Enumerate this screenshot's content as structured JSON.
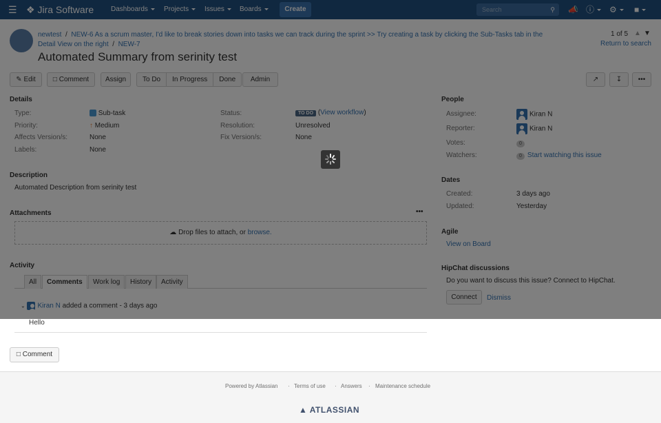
{
  "nav": {
    "brand": "Jira Software",
    "menus": [
      "Dashboards",
      "Projects",
      "Issues",
      "Boards"
    ],
    "create_label": "Create",
    "search_placeholder": "Search"
  },
  "breadcrumb": {
    "project": "newtest",
    "parent": "NEW-6 As a scrum master, I'd like to break stories down into tasks we can track during the sprint >> Try creating a task by clicking the Sub-Tasks tab in the",
    "parent_cont": "Detail View on the right",
    "issue_key": "NEW-7"
  },
  "pager": {
    "position": "1 of 5",
    "return_label": "Return to search"
  },
  "issue_title": "Automated Summary from serinity test",
  "toolbar": {
    "edit": "Edit",
    "comment": "Comment",
    "assign": "Assign",
    "todo": "To Do",
    "in_progress": "In Progress",
    "done": "Done",
    "admin": "Admin"
  },
  "details": {
    "heading": "Details",
    "type_label": "Type:",
    "type_value": "Sub-task",
    "priority_label": "Priority:",
    "priority_value": "Medium",
    "affects_label": "Affects Version/s:",
    "affects_value": "None",
    "labels_label": "Labels:",
    "labels_value": "None",
    "status_label": "Status:",
    "status_value": "TO DO",
    "view_workflow": "View workflow",
    "resolution_label": "Resolution:",
    "resolution_value": "Unresolved",
    "fix_label": "Fix Version/s:",
    "fix_value": "None"
  },
  "description": {
    "heading": "Description",
    "text": "Automated Description from serinity test"
  },
  "attachments": {
    "heading": "Attachments",
    "drop_text": "Drop files to attach, or",
    "browse": "browse."
  },
  "activity": {
    "heading": "Activity",
    "tabs": [
      "All",
      "Comments",
      "Work log",
      "History",
      "Activity"
    ],
    "active_tab": "Comments",
    "comment_author": "Kiran N",
    "comment_meta": "added a comment - 3 days ago",
    "comment_body": "Hello",
    "comment_button": "Comment"
  },
  "people": {
    "heading": "People",
    "assignee_label": "Assignee:",
    "assignee": "Kiran N",
    "reporter_label": "Reporter:",
    "reporter": "Kiran N",
    "votes_label": "Votes:",
    "votes": "0",
    "watchers_label": "Watchers:",
    "watchers": "0",
    "watch_link": "Start watching this issue"
  },
  "dates": {
    "heading": "Dates",
    "created_label": "Created:",
    "created": "3 days ago",
    "updated_label": "Updated:",
    "updated": "Yesterday"
  },
  "agile": {
    "heading": "Agile",
    "link": "View on Board"
  },
  "hipchat": {
    "heading": "HipChat discussions",
    "text": "Do you want to discuss this issue? Connect to HipChat.",
    "connect": "Connect",
    "dismiss": "Dismiss"
  },
  "footer": {
    "powered": "Powered by Atlassian",
    "terms": "Terms of use",
    "answers": "Answers",
    "maintenance": "Maintenance schedule",
    "logo": "ATLASSIAN"
  },
  "colors": {
    "nav": "#205081",
    "link": "#3572b0",
    "create": "#3b73af",
    "status_badge": "#4a6785"
  }
}
